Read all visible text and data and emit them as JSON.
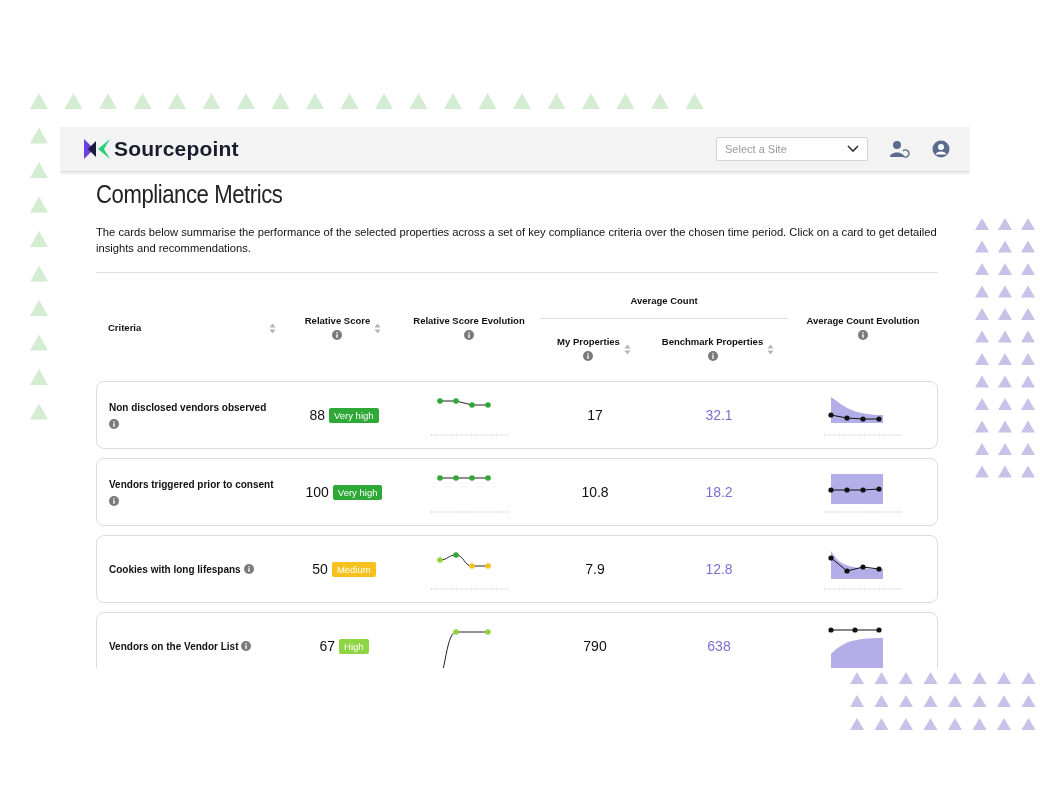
{
  "header": {
    "logo": "Sourcepoint",
    "site_select": {
      "placeholder": "Select a Site"
    }
  },
  "page": {
    "title": "Compliance Metrics",
    "description": "The cards below summarise the performance of the selected properties across a set of key compliance criteria over the chosen time period. Click on a card to get detailed insights and recommendations."
  },
  "table": {
    "columns": {
      "criteria": "Criteria",
      "relative_score": "Relative Score",
      "relative_score_evolution": "Relative Score Evolution",
      "average_count": "Average Count",
      "my_properties": "My Properties",
      "benchmark_properties": "Benchmark Properties",
      "average_count_evolution": "Average Count Evolution"
    },
    "rows": [
      {
        "criteria": "Non disclosed vendors observed",
        "score": "88",
        "badge": {
          "label": "Very high",
          "color": "#2ea836"
        },
        "my_properties": "17",
        "benchmark_properties": "32.1"
      },
      {
        "criteria": "Vendors triggered prior to consent",
        "score": "100",
        "badge": {
          "label": "Very high",
          "color": "#2ea836"
        },
        "my_properties": "10.8",
        "benchmark_properties": "18.2"
      },
      {
        "criteria": "Cookies with long lifespans",
        "score": "50",
        "badge": {
          "label": "Medium",
          "color": "#f7c21e"
        },
        "my_properties": "7.9",
        "benchmark_properties": "12.8"
      },
      {
        "criteria": "Vendors on the Vendor List",
        "score": "67",
        "badge": {
          "label": "High",
          "color": "#8fd443"
        },
        "my_properties": "790",
        "benchmark_properties": "638"
      }
    ]
  }
}
